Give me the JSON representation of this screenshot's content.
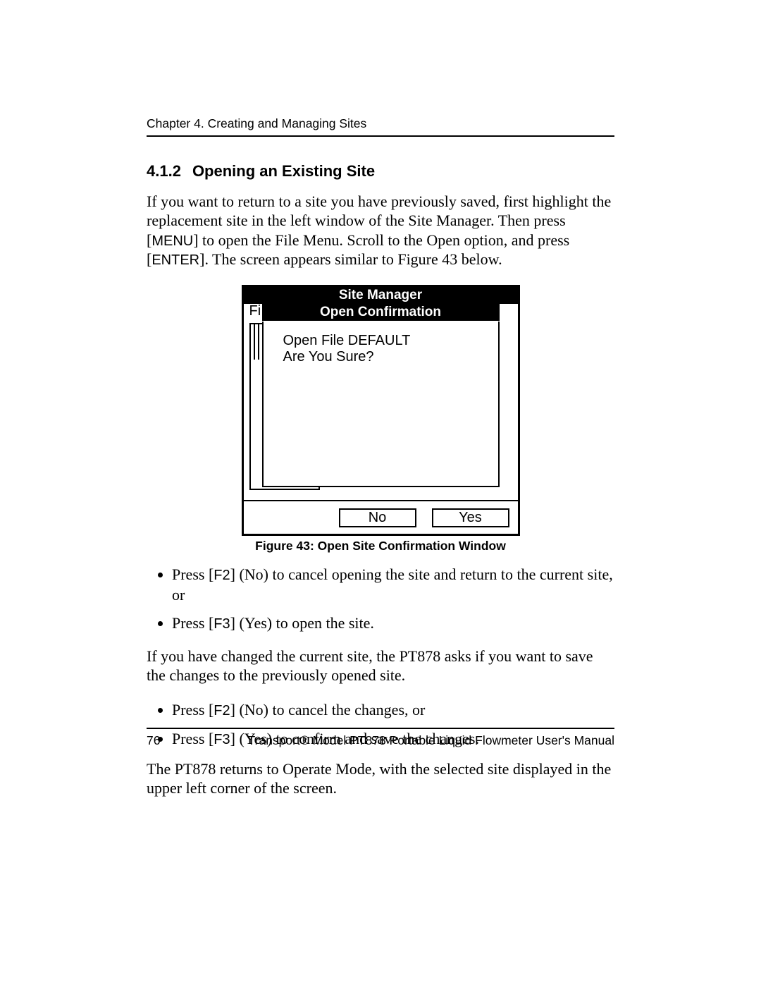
{
  "header": {
    "chapter": "Chapter 4. Creating and Managing Sites"
  },
  "section": {
    "number": "4.1.2",
    "title": "Opening an Existing Site"
  },
  "para_intro_pre": "If you want to return to a site you have previously saved, first highlight the replacement site in the left window of the Site Manager. Then press [",
  "key_menu": "MENU",
  "para_intro_mid": "] to open the File Menu. Scroll to the Open option, and press [",
  "key_enter": "ENTER",
  "para_intro_post": "]. The screen appears similar to Figure 43 below.",
  "device": {
    "title": "Site Manager",
    "menu_stub": "Fi",
    "dialog_title": "Open Confirmation",
    "line1": "Open File DEFAULT",
    "line2": "Are You Sure?",
    "btn_no": "No",
    "btn_yes": "Yes"
  },
  "figure_caption": "Figure 43: Open Site Confirmation Window",
  "bullet1_pre": "Press [",
  "key_f2": "F2",
  "bullet1_post": "] (No) to cancel opening the site and return to the current site, or",
  "bullet2_pre": "Press [",
  "key_f3": "F3",
  "bullet2_post": "] (Yes) to open the site.",
  "para_mid": "If you have changed the current site, the PT878 asks if you want to save the changes to the previously opened site.",
  "bullet3_pre": "Press [",
  "bullet3_post": "] (No) to cancel the changes, or",
  "bullet4_pre": "Press [",
  "bullet4_post": "] (Yes) to confirm and save the changes.",
  "para_end": "The PT878 returns to Operate Mode, with the selected site displayed in the upper left corner of the screen.",
  "footer": {
    "page": "76",
    "manual": "Transport® Model PT878 Portable Liquid Flowmeter User's Manual"
  }
}
